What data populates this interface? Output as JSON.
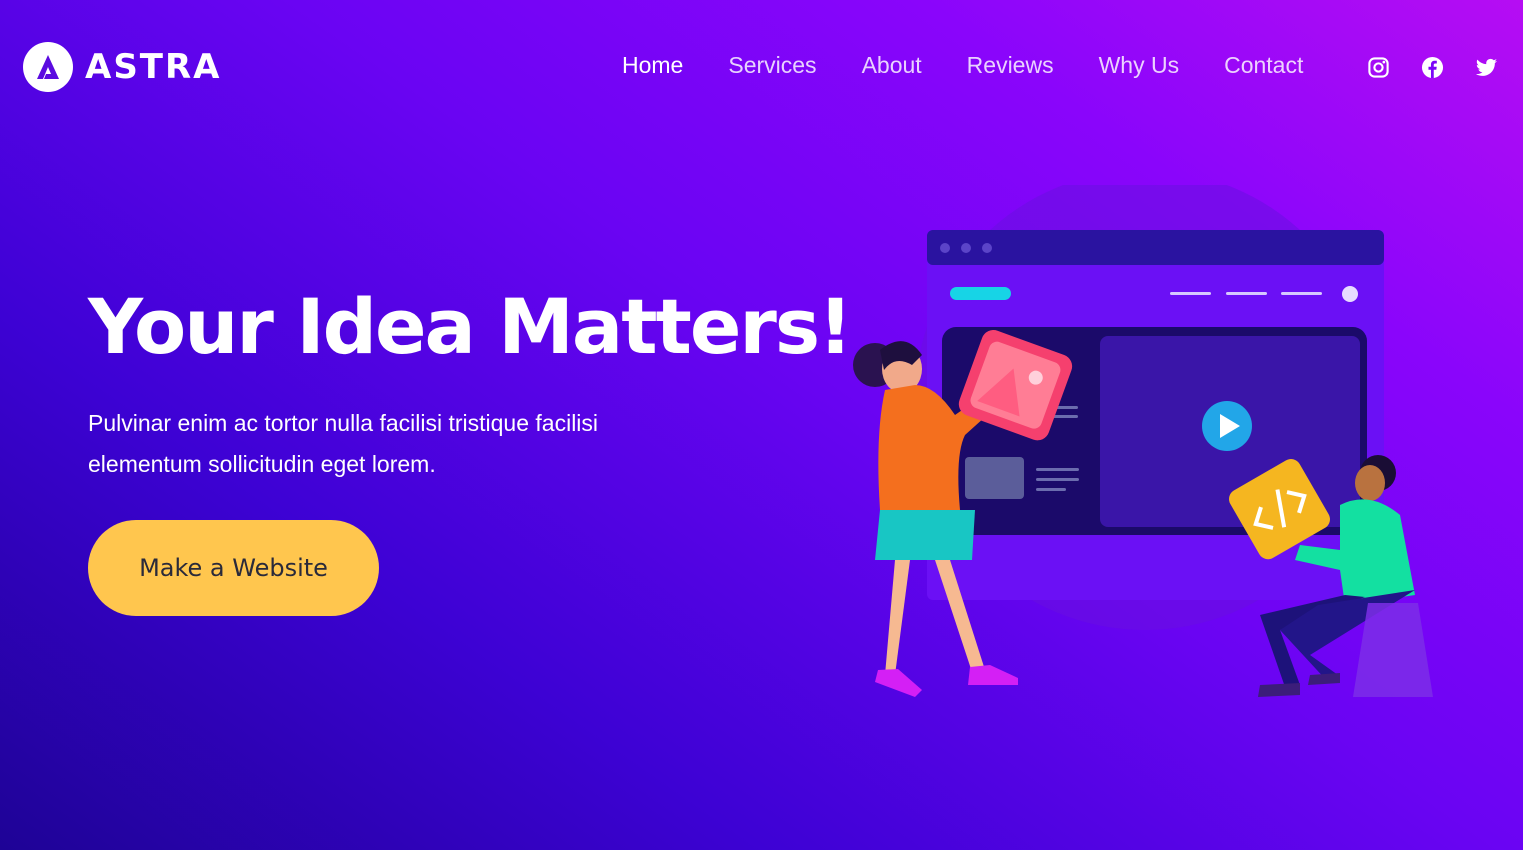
{
  "brand": {
    "name": "ASTRA",
    "logo_icon": "astra-logo-icon"
  },
  "nav": {
    "items": [
      {
        "label": "Home",
        "active": true
      },
      {
        "label": "Services",
        "active": false
      },
      {
        "label": "About",
        "active": false
      },
      {
        "label": "Reviews",
        "active": false
      },
      {
        "label": "Why Us",
        "active": false
      },
      {
        "label": "Contact",
        "active": false
      }
    ]
  },
  "socials": [
    "instagram-icon",
    "facebook-icon",
    "twitter-icon"
  ],
  "hero": {
    "title": "Your Idea Matters!",
    "subtitle": "Pulvinar enim ac tortor nulla facilisi tristique facilisi elementum sollicitudin eget lorem.",
    "cta_label": "Make a Website"
  },
  "colors": {
    "gradient_start": "#1e0396",
    "gradient_end": "#b60df3",
    "cta_background": "#ffc64e",
    "cta_text": "#2a2a3a"
  }
}
